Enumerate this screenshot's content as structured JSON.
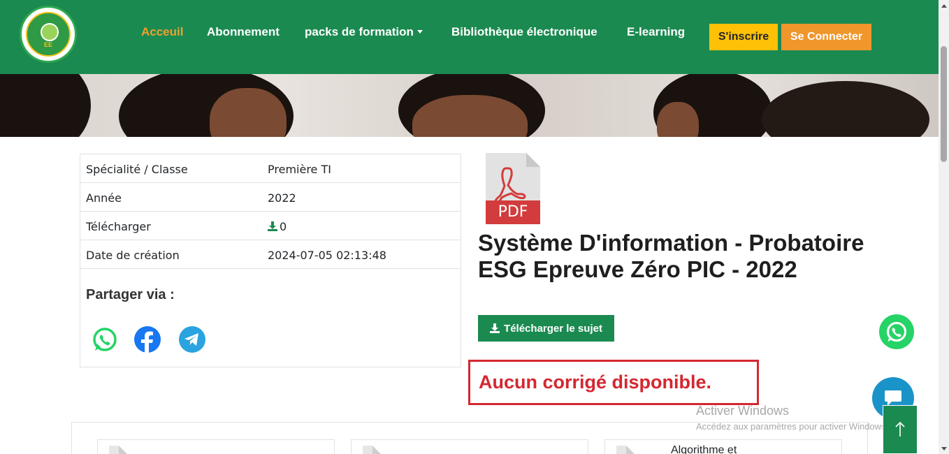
{
  "nav": {
    "logo_text": "EE",
    "logo_ring": "EPREUVE EXPRESS · TRAVAIL · SUCCES",
    "links": [
      {
        "label": "Acceuil",
        "active": true
      },
      {
        "label": "Abonnement",
        "active": false
      },
      {
        "label": "packs de formation",
        "active": false
      },
      {
        "label": "Bibliothèque électronique",
        "active": false
      },
      {
        "label": "E-learning",
        "active": false
      }
    ],
    "signup_label": "S'inscrire",
    "login_label": "Se Connecter"
  },
  "info": {
    "rows": [
      {
        "key": "Spécialité / Classe",
        "value": "Première TI"
      },
      {
        "key": "Année",
        "value": "2022"
      },
      {
        "key": "Télécharger",
        "value": "0"
      },
      {
        "key": "Date de création",
        "value": "2024-07-05 02:13:48"
      }
    ],
    "share_title": "Partager via :"
  },
  "document": {
    "pdf_label": "PDF",
    "title": "Système D'information - Probatoire ESG Epreuve Zéro PIC - 2022",
    "download_label": "Télécharger le sujet",
    "no_correction": "Aucun corrigé disponible."
  },
  "related": {
    "items": [
      {
        "title": ""
      },
      {
        "title": ""
      },
      {
        "title": "Algorithme et"
      }
    ]
  },
  "watermark": {
    "line1": "Activer Windows",
    "line2": "Accédez aux paramètres pour activer Windows."
  },
  "colors": {
    "brand_green": "#1b8a50",
    "accent_orange": "#f0962c",
    "accent_yellow": "#ffc107",
    "alert_red": "#d42730",
    "whatsapp": "#25d366",
    "facebook": "#1877f2",
    "telegram": "#2aa3e0"
  },
  "icons": [
    "whatsapp-icon",
    "facebook-icon",
    "telegram-icon",
    "download-icon",
    "pdf-icon",
    "chat-icon",
    "arrow-up-icon",
    "caret-down-icon"
  ]
}
